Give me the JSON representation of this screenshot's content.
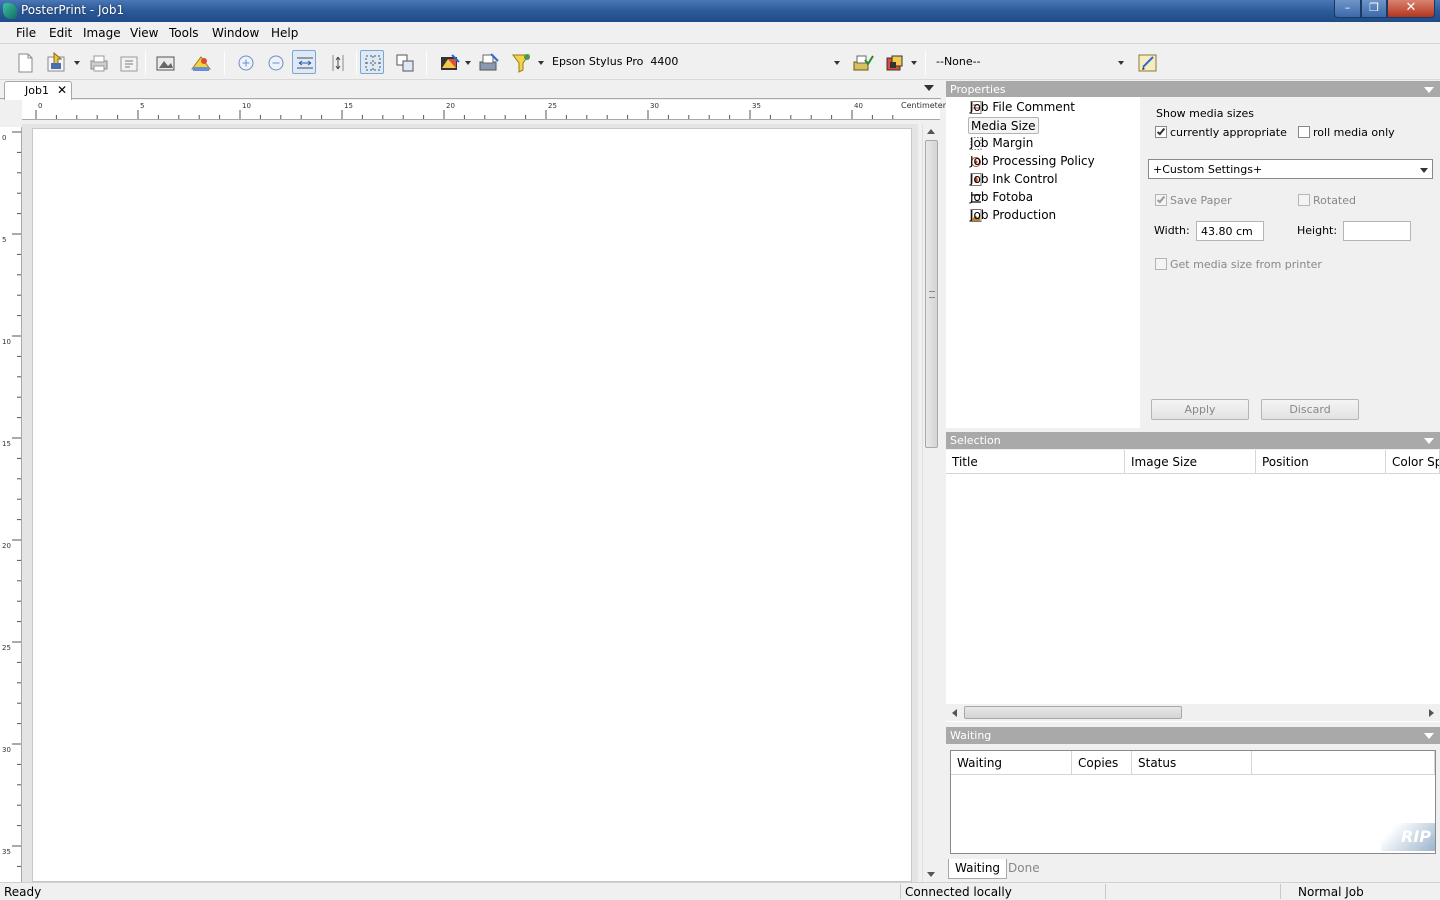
{
  "window": {
    "title": "PosterPrint - Job1",
    "controls": {
      "minimize": "–",
      "maximize": "❐",
      "close": "✕"
    }
  },
  "menu": [
    "File",
    "Edit",
    "Image",
    "View",
    "Tools",
    "Window",
    "Help"
  ],
  "toolbar": {
    "printer": "Epson Stylus Pro  4400",
    "preset": "--None--"
  },
  "document": {
    "tab_label": "Job1",
    "tab_close": "✕",
    "ruler_unit": "Centimeter",
    "h_ticks": [
      "0",
      "5",
      "10",
      "15",
      "20",
      "25",
      "30",
      "35",
      "40"
    ],
    "v_ticks": [
      "0",
      "5",
      "10",
      "15",
      "20",
      "25",
      "30",
      "35"
    ]
  },
  "properties": {
    "header": "Properties",
    "items": [
      {
        "label": "Job File Comment",
        "icon": "comment-doc-icon"
      },
      {
        "label": "Media Size",
        "icon": "media-size-icon",
        "selected": true
      },
      {
        "label": "Job Margin",
        "icon": "margin-icon"
      },
      {
        "label": "Job Processing Policy",
        "icon": "policy-icon"
      },
      {
        "label": "Job Ink Control",
        "icon": "ink-icon"
      },
      {
        "label": "Job Fotoba",
        "icon": "fotoba-icon"
      },
      {
        "label": "Job Production",
        "icon": "production-icon"
      }
    ],
    "form": {
      "show_media_sizes": "Show media sizes",
      "currently_appropriate": "currently appropriate",
      "currently_appropriate_checked": true,
      "roll_media_only": "roll media only",
      "roll_media_only_checked": false,
      "custom_settings": "+Custom Settings+",
      "save_paper": "Save Paper",
      "save_paper_checked": true,
      "rotated": "Rotated",
      "rotated_checked": false,
      "width_label": "Width:",
      "width_value": "43.80 cm",
      "height_label": "Height:",
      "height_value": "",
      "get_media_size": "Get media size from printer",
      "apply": "Apply",
      "discard": "Discard"
    }
  },
  "selection": {
    "header": "Selection",
    "columns": [
      "Title",
      "Image Size",
      "Position",
      "Color Sp..."
    ]
  },
  "waiting": {
    "header": "Waiting",
    "columns": [
      "Waiting",
      "Copies",
      "Status"
    ],
    "logo_text": "RIP",
    "tabs": [
      "Waiting",
      "Done"
    ]
  },
  "status": {
    "left": "Ready",
    "connection": "Connected locally",
    "job_type": "Normal Job"
  },
  "colors": {
    "titlebar": "#2c5a9a",
    "panel_header": "#a9a9a9"
  }
}
